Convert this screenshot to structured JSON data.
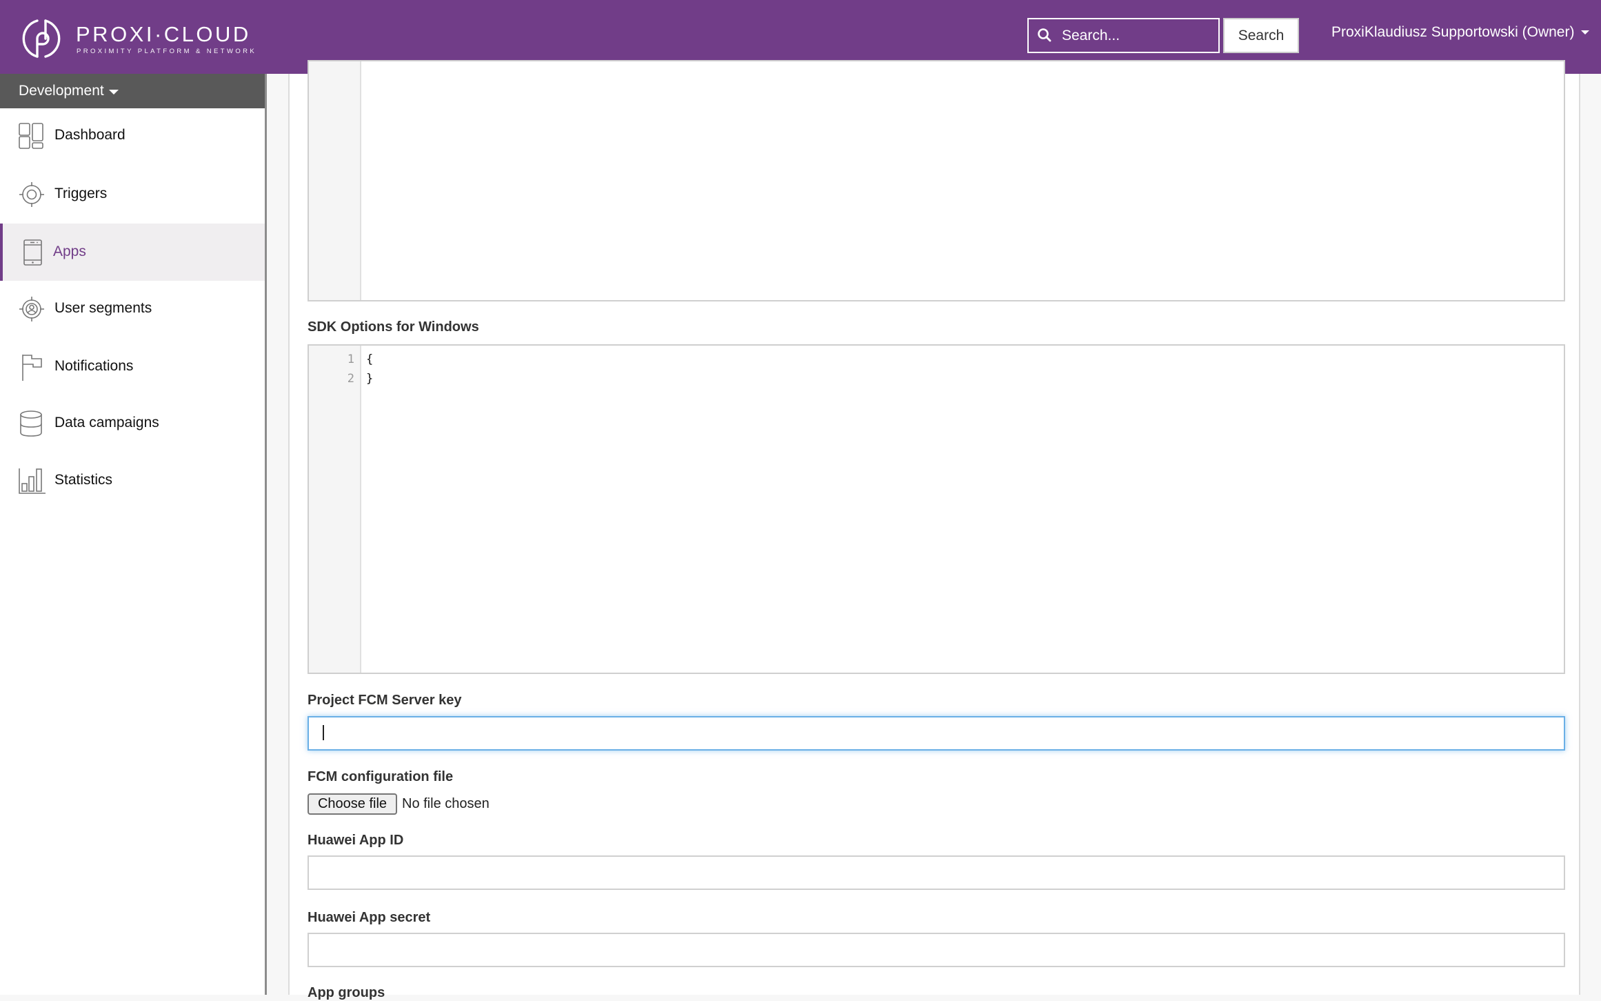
{
  "header": {
    "logo_title": "PROXI·CLOUD",
    "logo_subtitle": "PROXIMITY PLATFORM & NETWORK",
    "search_placeholder": "Search...",
    "search_button": "Search",
    "user_name": "ProxiKlaudiusz Supportowski (Owner)",
    "brand_color": "#713d88"
  },
  "sidebar": {
    "environment": "Development",
    "items": [
      {
        "label": "Dashboard",
        "icon": "dashboard-icon",
        "active": false
      },
      {
        "label": "Triggers",
        "icon": "target-icon",
        "active": false
      },
      {
        "label": "Apps",
        "icon": "tablet-icon",
        "active": true
      },
      {
        "label": "User segments",
        "icon": "user-target-icon",
        "active": false
      },
      {
        "label": "Notifications",
        "icon": "flag-icon",
        "active": false
      },
      {
        "label": "Data campaigns",
        "icon": "database-icon",
        "active": false
      },
      {
        "label": "Statistics",
        "icon": "bar-chart-icon",
        "active": false
      }
    ]
  },
  "form": {
    "sdk_windows": {
      "label": "SDK Options for Windows",
      "lines": [
        {
          "num": "1",
          "text": "{"
        },
        {
          "num": "2",
          "text": "}"
        }
      ]
    },
    "fcm_server_key": {
      "label": "Project FCM Server key",
      "value": ""
    },
    "fcm_config_file": {
      "label": "FCM configuration file",
      "button": "Choose file",
      "status": "No file chosen"
    },
    "huawei_app_id": {
      "label": "Huawei App ID",
      "value": ""
    },
    "huawei_app_secret": {
      "label": "Huawei App secret",
      "value": ""
    },
    "app_groups": {
      "label": "App groups"
    }
  }
}
